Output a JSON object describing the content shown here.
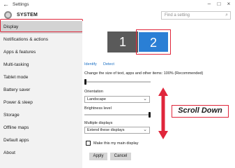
{
  "window": {
    "title": "Settings",
    "back_glyph": "←",
    "minimize_glyph": "–",
    "maximize_glyph": "□",
    "close_glyph": "×"
  },
  "header": {
    "title": "SYSTEM",
    "icon": "gear-icon",
    "search_placeholder": "Find a setting",
    "search_glyph": "⌕"
  },
  "sidebar": {
    "items": [
      {
        "label": "Display",
        "selected": true
      },
      {
        "label": "Notifications & actions"
      },
      {
        "label": "Apps & features"
      },
      {
        "label": "Multi-tasking"
      },
      {
        "label": "Tablet mode"
      },
      {
        "label": "Battery saver"
      },
      {
        "label": "Power & sleep"
      },
      {
        "label": "Storage"
      },
      {
        "label": "Offline maps"
      },
      {
        "label": "Default apps"
      },
      {
        "label": "About"
      }
    ]
  },
  "main": {
    "monitors": [
      "1",
      "2"
    ],
    "identify": "Identify",
    "detect": "Detect",
    "scale_label": "Change the size of text, apps and other items: 100% (Recommended)",
    "scale_value": 0.0,
    "orientation_label": "Orientation",
    "orientation_value": "Landscape",
    "brightness_label": "Brightness level",
    "brightness_value": 1.0,
    "multiple_displays_label": "Multiple displays",
    "multiple_displays_value": "Extend these displays",
    "main_display_label": "Make this my main display",
    "main_display_checked": false,
    "apply": "Apply",
    "cancel": "Cancel"
  },
  "annotation": {
    "callout": "Scroll Down",
    "accent_color": "#e0263b"
  },
  "colors": {
    "selected_monitor": "#2a7fd5",
    "other_monitor": "#5a5a5a",
    "link": "#1a6fc4",
    "sidebar_bg": "#f2f2f2",
    "sidebar_selected": "#d3d3d3"
  }
}
